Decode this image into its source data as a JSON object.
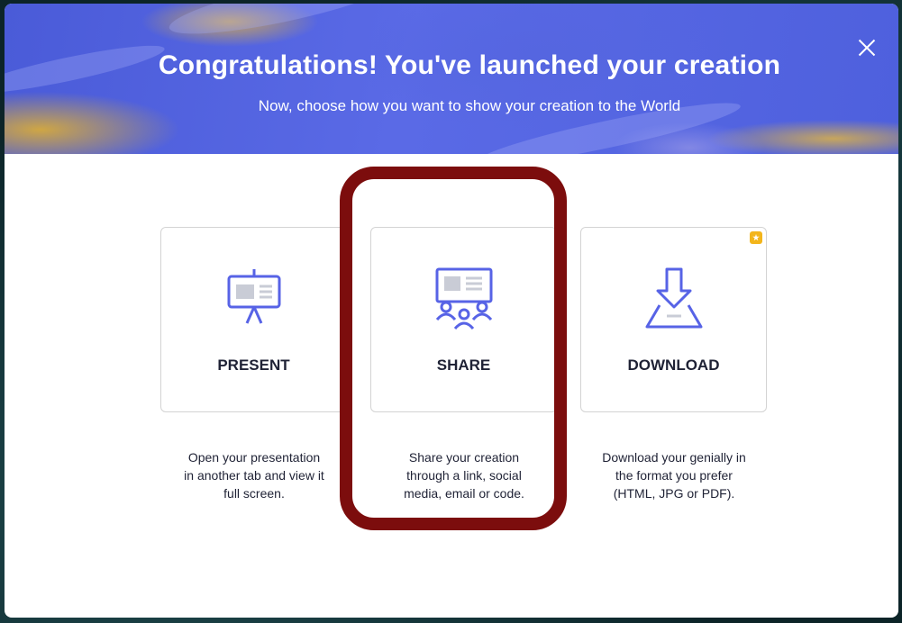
{
  "banner": {
    "title": "Congratulations! You've launched your creation",
    "subtitle": "Now, choose how you want to show your creation to the World",
    "close_icon": "close-icon"
  },
  "options": [
    {
      "label": "PRESENT",
      "description_lines": [
        "Open your presentation",
        "in another tab and view it",
        "full screen."
      ],
      "icon": "presentation-board-icon"
    },
    {
      "label": "SHARE",
      "description_lines": [
        "Share your creation",
        "through a link, social",
        "media, email or code."
      ],
      "icon": "audience-presentation-icon"
    },
    {
      "label": "DOWNLOAD",
      "description_lines": [
        "Download your genially in",
        "the format you prefer",
        "(HTML, JPG or PDF)."
      ],
      "icon": "download-arrow-icon",
      "premium_badge_icon": "star-badge-icon"
    }
  ],
  "colors": {
    "accent_icon": "#5763e6",
    "banner_blue": "#4e60dd",
    "highlight_outline": "#7c0d0d",
    "premium_badge": "#f3b51b"
  }
}
